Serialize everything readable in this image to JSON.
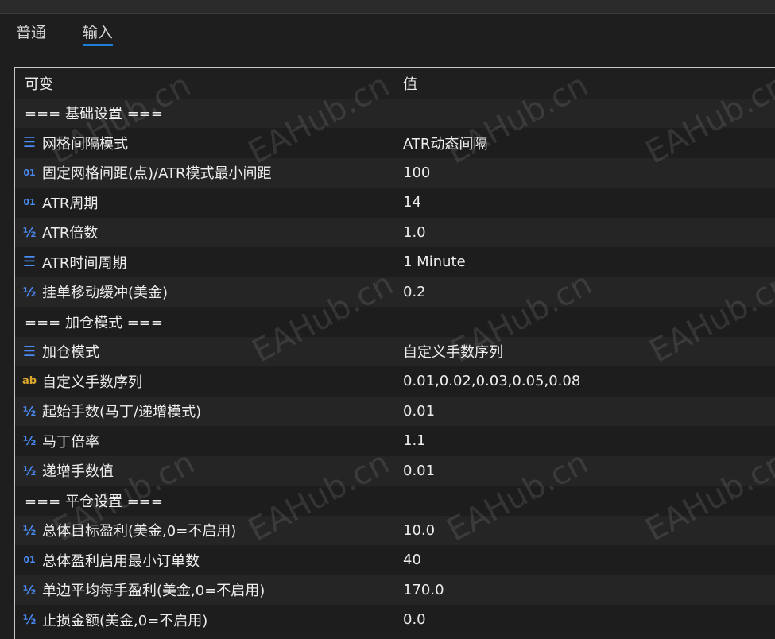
{
  "tabs": [
    {
      "label": "普通"
    },
    {
      "label": "输入"
    }
  ],
  "table": {
    "headers": [
      "可变",
      "值"
    ],
    "rows": [
      {
        "icon": "",
        "name": "=== 基础设置 ===",
        "value": ""
      },
      {
        "icon": "enum-icon",
        "name": "网格间隔模式",
        "value": "ATR动态间隔"
      },
      {
        "icon": "int-icon",
        "name": "固定网格间距(点)/ATR模式最小间距",
        "value": "100"
      },
      {
        "icon": "int-icon",
        "name": "ATR周期",
        "value": "14"
      },
      {
        "icon": "double-icon",
        "name": "ATR倍数",
        "value": "1.0"
      },
      {
        "icon": "enum-icon",
        "name": "ATR时间周期",
        "value": "1 Minute"
      },
      {
        "icon": "double-icon",
        "name": "挂单移动缓冲(美金)",
        "value": "0.2"
      },
      {
        "icon": "",
        "name": "=== 加仓模式 ===",
        "value": ""
      },
      {
        "icon": "enum-icon",
        "name": "加仓模式",
        "value": "自定义手数序列"
      },
      {
        "icon": "string-icon",
        "name": "自定义手数序列",
        "value": "0.01,0.02,0.03,0.05,0.08"
      },
      {
        "icon": "double-icon",
        "name": "起始手数(马丁/递增模式)",
        "value": "0.01"
      },
      {
        "icon": "double-icon",
        "name": "马丁倍率",
        "value": "1.1"
      },
      {
        "icon": "double-icon",
        "name": "递增手数值",
        "value": "0.01"
      },
      {
        "icon": "",
        "name": "=== 平仓设置 ===",
        "value": ""
      },
      {
        "icon": "double-icon",
        "name": "总体目标盈利(美金,0=不启用)",
        "value": "10.0"
      },
      {
        "icon": "int-icon",
        "name": "总体盈利启用最小订单数",
        "value": "40"
      },
      {
        "icon": "double-icon",
        "name": "单边平均每手盈利(美金,0=不启用)",
        "value": "170.0"
      },
      {
        "icon": "double-icon",
        "name": "止损金额(美金,0=不启用)",
        "value": "0.0"
      }
    ]
  },
  "icons": {
    "enum-icon": "☰",
    "int-icon": "01",
    "double-icon": "½",
    "string-icon": "ab"
  },
  "watermark": "EAHub.cn",
  "colors": {
    "accent": "#1c7cd6",
    "icon_blue": "#4a8bf5",
    "icon_orange": "#d9a52b"
  }
}
